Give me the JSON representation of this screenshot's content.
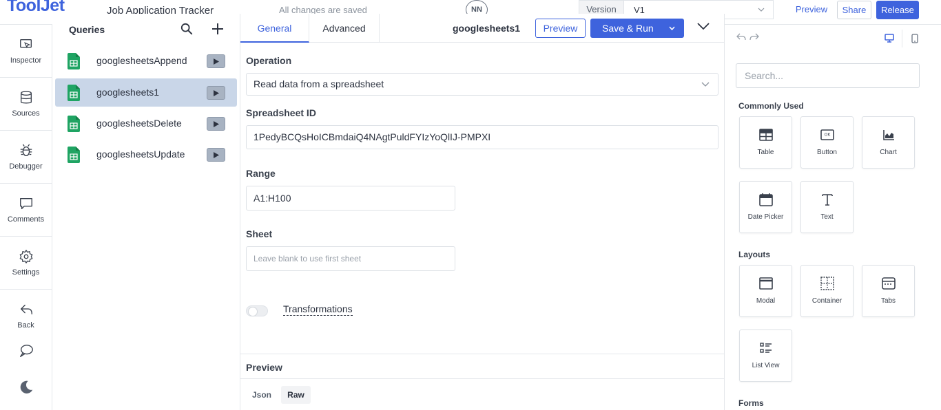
{
  "header": {
    "logo": "ToolJet",
    "app_name": "Job Application Tracker",
    "save_status": "All changes are saved",
    "avatar_initials": "NN",
    "version_label": "Version",
    "version_value": "V1",
    "preview_label": "Preview",
    "share_label": "Share",
    "release_label": "Release",
    "accent_color": "#3e63dd"
  },
  "leftnav": {
    "items": [
      {
        "label": "Inspector",
        "icon": "inspector-icon"
      },
      {
        "label": "Sources",
        "icon": "database-icon"
      },
      {
        "label": "Debugger",
        "icon": "bug-icon"
      },
      {
        "label": "Comments",
        "icon": "comment-icon"
      },
      {
        "label": "Settings",
        "icon": "gear-icon"
      },
      {
        "label": "Back",
        "icon": "back-arrow-icon"
      }
    ],
    "extra_icons": [
      "chat-bubble-icon",
      "moon-icon"
    ]
  },
  "queries": {
    "title": "Queries",
    "items": [
      {
        "name": "googlesheetsAppend",
        "selected": false
      },
      {
        "name": "googlesheets1",
        "selected": true
      },
      {
        "name": "googlesheetsDelete",
        "selected": false
      },
      {
        "name": "googlesheetsUpdate",
        "selected": false
      }
    ]
  },
  "editor": {
    "tabs": [
      "General",
      "Advanced"
    ],
    "active_tab": "General",
    "query_name": "googlesheets1",
    "preview_label": "Preview",
    "save_run_label": "Save & Run",
    "operation_label": "Operation",
    "operation_value": "Read data from a spreadsheet",
    "spreadsheet_id_label": "Spreadsheet ID",
    "spreadsheet_id_value": "1PedyBCQsHoICBmdaiQ4NAgtPuldFYIzYoQlIJ-PMPXI",
    "range_label": "Range",
    "range_value": "A1:H100",
    "sheet_label": "Sheet",
    "sheet_placeholder": "Leave blank to use first sheet",
    "transformations_label": "Transformations",
    "preview_section_title": "Preview",
    "preview_tabs": [
      "Json",
      "Raw"
    ],
    "preview_active_tab": "Raw"
  },
  "widgets": {
    "search_placeholder": "Search...",
    "commonly_used_title": "Commonly Used",
    "commonly_used": [
      {
        "label": "Table",
        "icon": "table-icon"
      },
      {
        "label": "Button",
        "icon": "button-icon"
      },
      {
        "label": "Chart",
        "icon": "chart-icon"
      },
      {
        "label": "Date Picker",
        "icon": "calendar-icon"
      },
      {
        "label": "Text",
        "icon": "text-icon"
      }
    ],
    "layouts_title": "Layouts",
    "layouts": [
      {
        "label": "Modal",
        "icon": "modal-icon"
      },
      {
        "label": "Container",
        "icon": "container-icon"
      },
      {
        "label": "Tabs",
        "icon": "tabs-icon"
      },
      {
        "label": "List View",
        "icon": "list-view-icon"
      }
    ],
    "forms_title": "Forms"
  }
}
